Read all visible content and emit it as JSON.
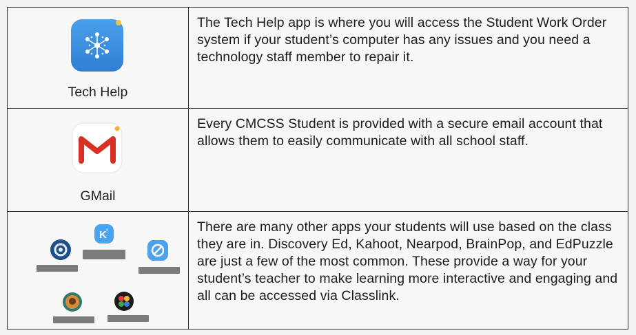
{
  "rows": [
    {
      "app_name": "Tech Help",
      "icon": "tech-help-icon",
      "description": "The Tech Help app is where you will access the Student Work Order system if your student’s computer has any issues and you need a technology staff member to repair it."
    },
    {
      "app_name": "GMail",
      "icon": "gmail-icon",
      "description": "Every CMCSS Student is provided with a secure email account that allows them to easily communicate with all school staff."
    },
    {
      "app_name": "",
      "icon": "app-collage",
      "description": "There are many other apps your students will use based on the class they are in.  Discovery Ed, Kahoot, Nearpod, BrainPop, and EdPuzzle are just a few of the most common.  These provide a way for your student’s teacher to make learning more interactive and engaging and all can be accessed via Classlink."
    }
  ],
  "colors": {
    "tech_blue": "#3b8fe0",
    "gmail_red": "#d93025",
    "kahoot_blue": "#4aa3ee",
    "caption_gray": "#7b7b7b"
  }
}
